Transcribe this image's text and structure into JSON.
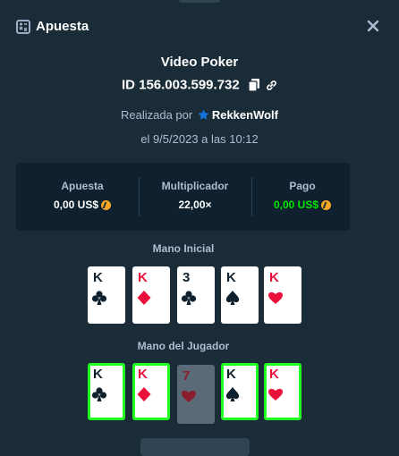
{
  "header": {
    "title": "Apuesta"
  },
  "game": {
    "title": "Video Poker",
    "bet_id": "ID 156.003.599.732"
  },
  "placed": {
    "prefix": "Realizada por",
    "user": "RekkenWolf"
  },
  "date": "el 9/5/2023 a las 10:12",
  "stats": {
    "wager_label": "Apuesta",
    "wager_value": "0,00 US$",
    "multiplier_label": "Multiplicador",
    "multiplier_value": "22,00×",
    "payout_label": "Pago",
    "payout_value": "0,00 US$"
  },
  "initial_hand": {
    "label": "Mano Inicial",
    "cards": [
      {
        "rank": "K",
        "suit": "clubs"
      },
      {
        "rank": "K",
        "suit": "diamonds"
      },
      {
        "rank": "3",
        "suit": "clubs"
      },
      {
        "rank": "K",
        "suit": "spades"
      },
      {
        "rank": "K",
        "suit": "hearts"
      }
    ]
  },
  "player_hand": {
    "label": "Mano del Jugador",
    "cards": [
      {
        "rank": "K",
        "suit": "clubs",
        "held": true
      },
      {
        "rank": "K",
        "suit": "diamonds",
        "held": true
      },
      {
        "rank": "7",
        "suit": "hearts",
        "held": false
      },
      {
        "rank": "K",
        "suit": "spades",
        "held": true
      },
      {
        "rank": "K",
        "suit": "hearts",
        "held": true
      }
    ]
  },
  "colors": {
    "background": "#1a2c38",
    "panel": "#0f212e",
    "win_green": "#00e701",
    "card_red": "#e9113c"
  },
  "icons": [
    "bet-slip-icon",
    "close-icon",
    "copy-icon",
    "link-icon",
    "verified-star-icon",
    "coin-icon"
  ]
}
